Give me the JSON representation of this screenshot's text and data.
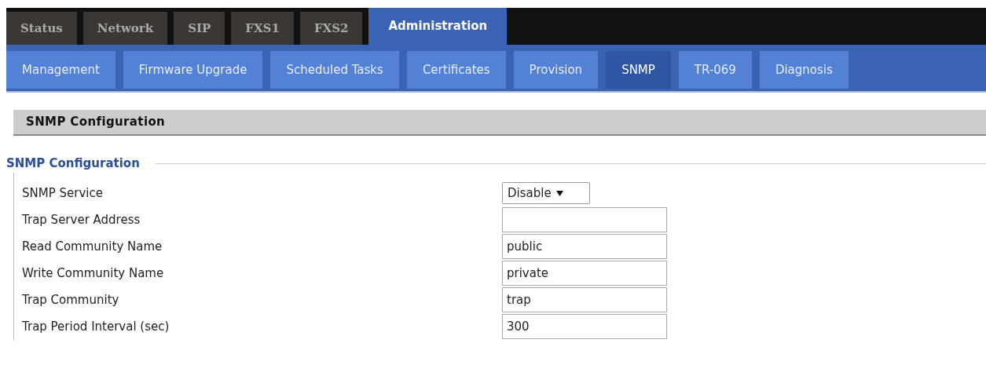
{
  "main_tabs": [
    {
      "label": "Status",
      "selected": false
    },
    {
      "label": "Network",
      "selected": false
    },
    {
      "label": "SIP",
      "selected": false
    },
    {
      "label": "FXS1",
      "selected": false
    },
    {
      "label": "FXS2",
      "selected": false
    },
    {
      "label": "Administration",
      "selected": true
    }
  ],
  "sub_tabs": [
    {
      "label": "Management",
      "selected": false
    },
    {
      "label": "Firmware Upgrade",
      "selected": false
    },
    {
      "label": "Scheduled Tasks",
      "selected": false
    },
    {
      "label": "Certificates",
      "selected": false
    },
    {
      "label": "Provision",
      "selected": false
    },
    {
      "label": "SNMP",
      "selected": true
    },
    {
      "label": "TR-069",
      "selected": false
    },
    {
      "label": "Diagnosis",
      "selected": false
    }
  ],
  "section_title": "SNMP Configuration",
  "fieldset": {
    "legend": "SNMP Configuration",
    "fields": [
      {
        "label": "SNMP Service",
        "kind": "select",
        "value": "Disable"
      },
      {
        "label": "Trap Server Address",
        "kind": "text"
      },
      {
        "label": "Read Community Name",
        "kind": "text",
        "value": "public"
      },
      {
        "label": "Write Community Name",
        "kind": "text",
        "value": "private"
      },
      {
        "label": "Trap Community",
        "kind": "text",
        "value": "trap"
      },
      {
        "label": "Trap Period Interval (sec)",
        "kind": "text",
        "value": "300"
      }
    ]
  }
}
